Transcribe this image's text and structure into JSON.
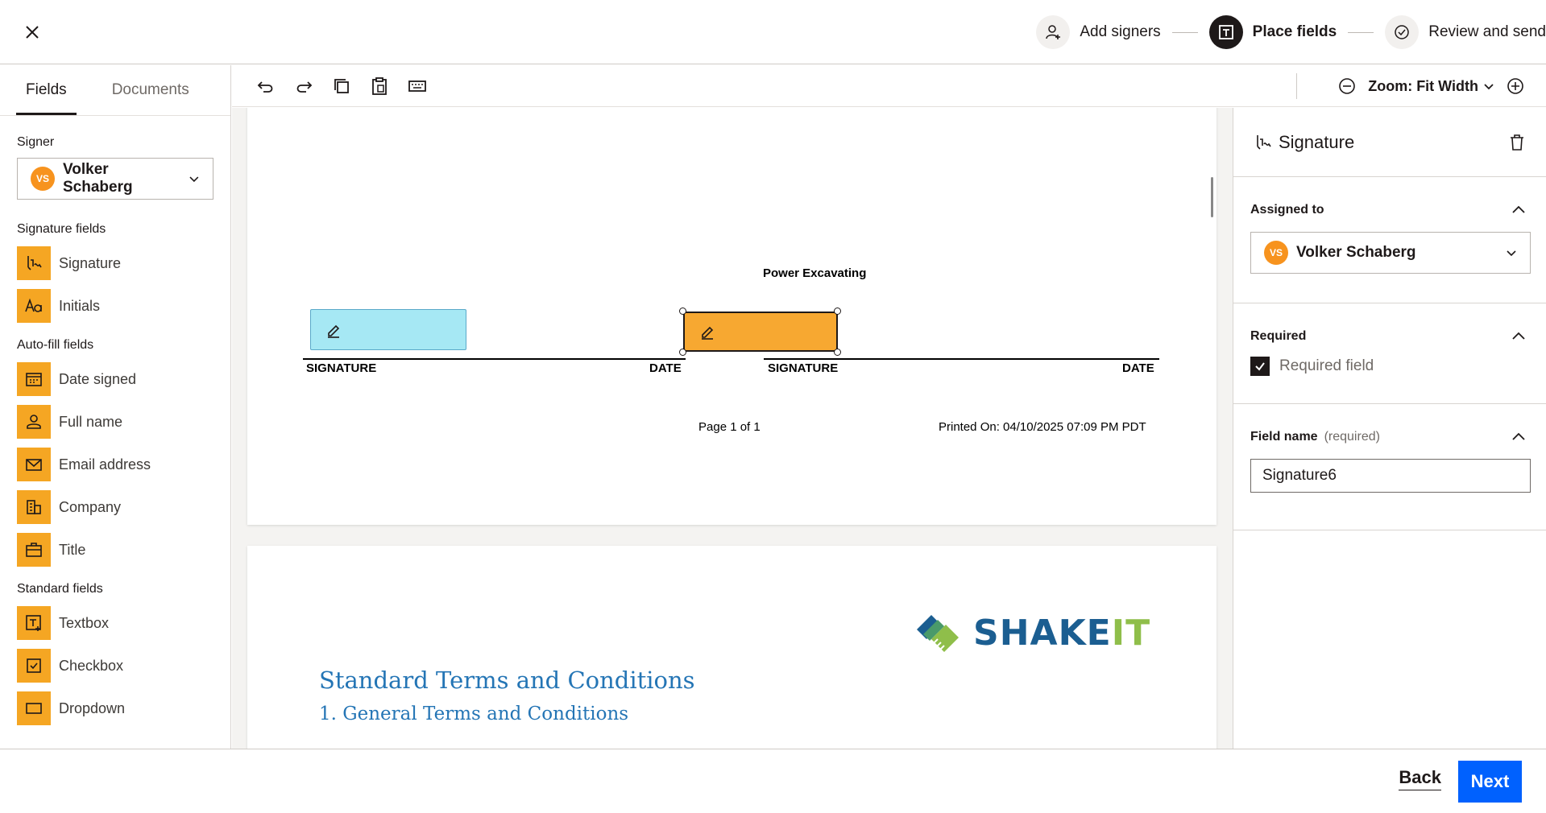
{
  "header": {
    "steps": [
      {
        "label": "Add signers",
        "icon": "add-person-icon",
        "active": false
      },
      {
        "label": "Place fields",
        "icon": "text-field-icon",
        "active": true
      },
      {
        "label": "Review and send",
        "icon": "check-circle-icon",
        "active": false
      }
    ]
  },
  "left_panel": {
    "tabs": [
      "Fields",
      "Documents"
    ],
    "signer_label": "Signer",
    "signer": {
      "initials": "VS",
      "name": "Volker Schaberg"
    },
    "groups": {
      "signature": {
        "label": "Signature fields",
        "items": [
          "Signature",
          "Initials"
        ]
      },
      "autofill": {
        "label": "Auto-fill fields",
        "items": [
          "Date signed",
          "Full name",
          "Email address",
          "Company",
          "Title"
        ]
      },
      "standard": {
        "label": "Standard fields",
        "items": [
          "Textbox",
          "Checkbox",
          "Dropdown"
        ]
      }
    }
  },
  "toolbar": {
    "zoom_label": "Zoom: Fit Width"
  },
  "document": {
    "company_title": "Power Excavating",
    "signature_label": "SIGNATURE",
    "date_label": "DATE",
    "page_info": "Page 1 of 1",
    "printed_on": "Printed On: 04/10/2025 07:09 PM PDT",
    "logo_text_a": "SHAKE",
    "logo_text_b": "IT",
    "terms_title": "Standard Terms and Conditions",
    "terms_sub": "1.      General Terms and Conditions"
  },
  "right_panel": {
    "title": "Signature",
    "assigned_label": "Assigned to",
    "assigned": {
      "initials": "VS",
      "name": "Volker Schaberg"
    },
    "required_label": "Required",
    "required_checkbox_label": "Required field",
    "required_checked": true,
    "field_name_label": "Field name",
    "field_name_required": "(required)",
    "field_name_value": "Signature6"
  },
  "footer": {
    "back_label": "Back",
    "next_label": "Next"
  },
  "colors": {
    "accent": "#0061fe",
    "field_orange": "#f5a623",
    "field_blue": "#a6e8f4",
    "avatar": "#f7931e"
  }
}
